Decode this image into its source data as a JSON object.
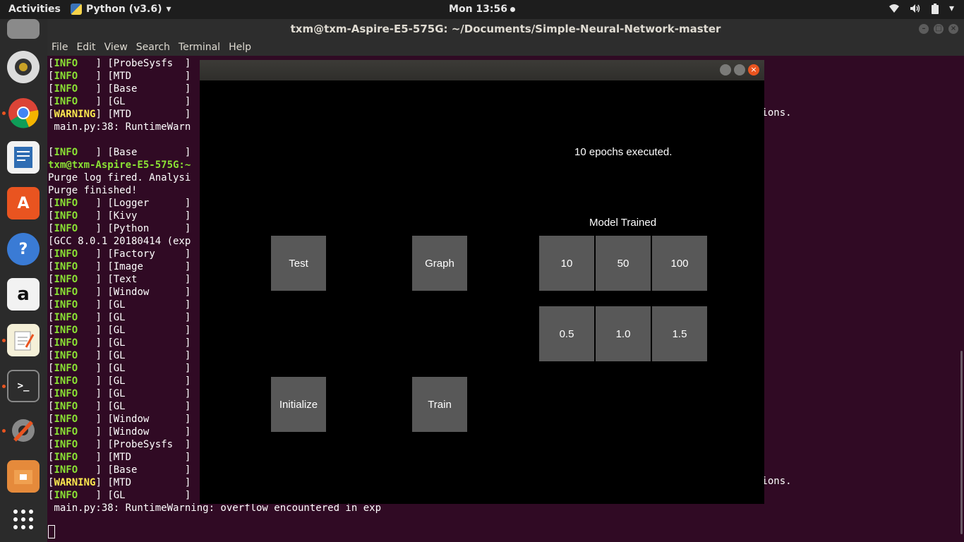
{
  "topbar": {
    "activities": "Activities",
    "app_name": "Python (v3.6)",
    "clock": "Mon 13:56"
  },
  "terminal": {
    "title": "txm@txm-Aspire-E5-575G: ~/Documents/Simple-Neural-Network-master",
    "menu": [
      "File",
      "Edit",
      "View",
      "Search",
      "Terminal",
      "Help"
    ],
    "lines": [
      {
        "lvl": "INFO",
        "tag": "[ProbeSysfs  ]"
      },
      {
        "lvl": "INFO",
        "tag": "[MTD         ]"
      },
      {
        "lvl": "INFO",
        "tag": "[Base        ]"
      },
      {
        "lvl": "INFO",
        "tag": "[GL          ]"
      },
      {
        "lvl": "WARNING",
        "tag": "[MTD         ]"
      },
      {
        "text": " main.py:38: RuntimeWarn"
      },
      {
        "text": ""
      },
      {
        "lvl": "INFO",
        "tag": "[Base        ]"
      },
      {
        "prompt": "txm@txm-Aspire-E5-575G:~"
      },
      {
        "text": "Purge log fired. Analysi"
      },
      {
        "text": "Purge finished!"
      },
      {
        "lvl": "INFO",
        "tag": "[Logger      ]"
      },
      {
        "lvl": "INFO",
        "tag": "[Kivy        ]"
      },
      {
        "lvl": "INFO",
        "tag": "[Python      ]"
      },
      {
        "text": "[GCC 8.0.1 20180414 (exp"
      },
      {
        "lvl": "INFO",
        "tag": "[Factory     ]"
      },
      {
        "lvl": "INFO",
        "tag": "[Image       ]"
      },
      {
        "lvl": "INFO",
        "tag": "[Text        ]"
      },
      {
        "lvl": "INFO",
        "tag": "[Window      ]"
      },
      {
        "lvl": "INFO",
        "tag": "[GL          ]"
      },
      {
        "lvl": "INFO",
        "tag": "[GL          ]"
      },
      {
        "lvl": "INFO",
        "tag": "[GL          ]"
      },
      {
        "lvl": "INFO",
        "tag": "[GL          ]"
      },
      {
        "lvl": "INFO",
        "tag": "[GL          ]"
      },
      {
        "lvl": "INFO",
        "tag": "[GL          ]"
      },
      {
        "lvl": "INFO",
        "tag": "[GL          ]"
      },
      {
        "lvl": "INFO",
        "tag": "[GL          ]"
      },
      {
        "lvl": "INFO",
        "tag": "[GL          ]"
      },
      {
        "lvl": "INFO",
        "tag": "[Window      ]"
      },
      {
        "lvl": "INFO",
        "tag": "[Window      ]"
      },
      {
        "lvl": "INFO",
        "tag": "[ProbeSysfs  ]"
      },
      {
        "lvl": "INFO",
        "tag": "[MTD         ]"
      },
      {
        "lvl": "INFO",
        "tag": "[Base        ]"
      },
      {
        "lvl": "WARNING",
        "tag": "[MTD         ]"
      },
      {
        "lvl": "INFO",
        "tag": "[GL          ]"
      },
      {
        "text": " main.py:38: RuntimeWarning: overflow encountered in exp"
      }
    ],
    "right_fragment_1": "sions.",
    "right_fragment_2": "sions."
  },
  "kivy": {
    "status": "10 epochs executed.",
    "model_label": "Model Trained",
    "buttons": {
      "test": "Test",
      "graph": "Graph",
      "initialize": "Initialize",
      "train": "Train",
      "e10": "10",
      "e50": "50",
      "e100": "100",
      "lr05": "0.5",
      "lr10": "1.0",
      "lr15": "1.5"
    }
  }
}
